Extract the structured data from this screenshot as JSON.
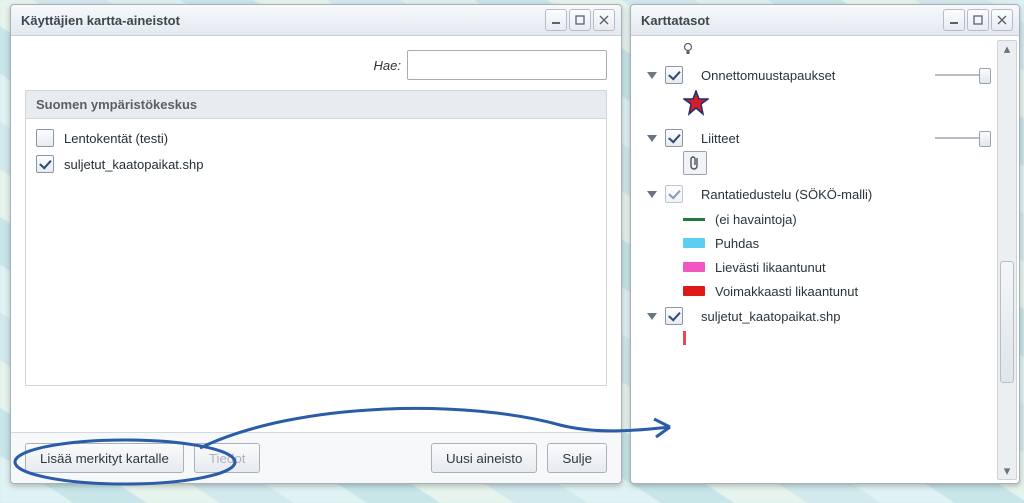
{
  "left": {
    "title": "Käyttäjien kartta-aineistot",
    "search_label": "Hae:",
    "search_value": "",
    "group_header": "Suomen ympäristökeskus",
    "items": [
      {
        "label": "Lentokentät (testi)",
        "checked": false
      },
      {
        "label": "suljetut_kaatopaikat.shp",
        "checked": true
      }
    ],
    "buttons": {
      "add": "Lisää merkityt kartalle",
      "info": "Tiedot",
      "new": "Uusi aineisto",
      "close": "Sulje"
    }
  },
  "right": {
    "title": "Karttatasot",
    "layers": {
      "l0": {
        "label": "Onnettomuustapaukset"
      },
      "l1": {
        "label": "Liitteet"
      },
      "l2": {
        "label": "Rantatiedustelu (SÖKÖ-malli)",
        "legend": [
          {
            "label": "(ei havaintoja)",
            "color": null,
            "stroke": "#1f7a3e"
          },
          {
            "label": "Puhdas",
            "color": "#5ecdf2"
          },
          {
            "label": "Lievästi likaantunut",
            "color": "#f356c3"
          },
          {
            "label": "Voimakkaasti likaantunut",
            "color": "#e11818"
          }
        ]
      },
      "l3": {
        "label": "suljetut_kaatopaikat.shp"
      }
    }
  }
}
